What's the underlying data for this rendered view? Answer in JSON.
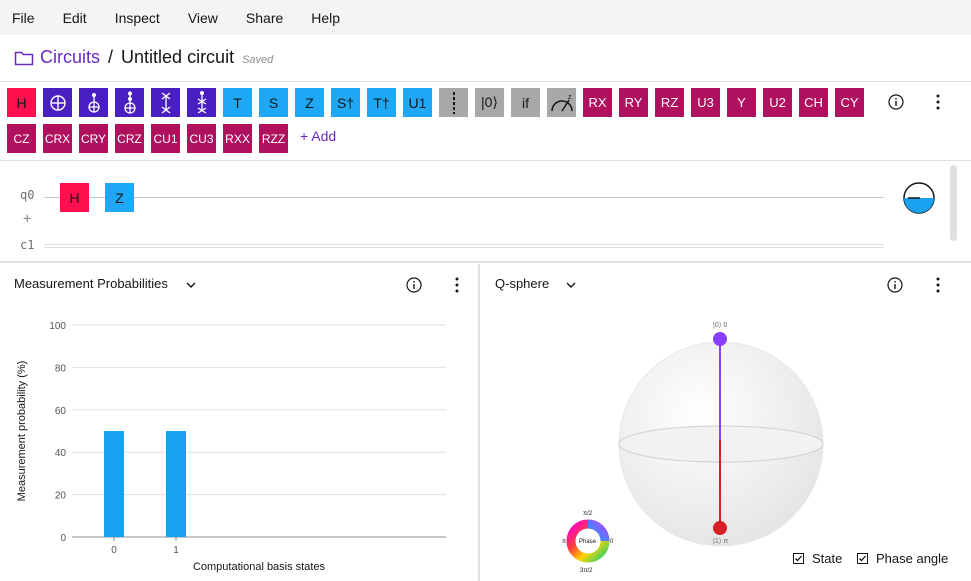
{
  "menu": [
    "File",
    "Edit",
    "Inspect",
    "View",
    "Share",
    "Help"
  ],
  "breadcrumb": {
    "root": "Circuits",
    "separator": "/",
    "title": "Untitled circuit",
    "status": "Saved"
  },
  "gates_row1": [
    {
      "label": "H",
      "kind": "red"
    },
    {
      "label": "",
      "kind": "purple",
      "icon": "cnot-icon"
    },
    {
      "label": "",
      "kind": "purple",
      "icon": "toffoli-icon"
    },
    {
      "label": "",
      "kind": "purple",
      "icon": "ccx-icon"
    },
    {
      "label": "",
      "kind": "purple",
      "icon": "swap-icon"
    },
    {
      "label": "",
      "kind": "purple",
      "icon": "cswap-icon"
    },
    {
      "label": "T",
      "kind": "blue"
    },
    {
      "label": "S",
      "kind": "blue"
    },
    {
      "label": "Z",
      "kind": "blue"
    },
    {
      "label": "S†",
      "kind": "blue"
    },
    {
      "label": "T†",
      "kind": "blue"
    },
    {
      "label": "U1",
      "kind": "blue"
    },
    {
      "label": "",
      "kind": "gray",
      "icon": "barrier-icon"
    },
    {
      "label": "|0⟩",
      "kind": "gray"
    },
    {
      "label": "if",
      "kind": "gray"
    },
    {
      "label": "",
      "kind": "gray",
      "icon": "measure-icon"
    },
    {
      "label": "RX",
      "kind": "magenta"
    },
    {
      "label": "RY",
      "kind": "magenta"
    },
    {
      "label": "RZ",
      "kind": "magenta"
    },
    {
      "label": "U3",
      "kind": "magenta"
    },
    {
      "label": "Y",
      "kind": "magenta"
    },
    {
      "label": "U2",
      "kind": "magenta"
    },
    {
      "label": "CH",
      "kind": "magenta"
    },
    {
      "label": "CY",
      "kind": "magenta"
    }
  ],
  "gates_row2": [
    {
      "label": "CZ",
      "kind": "magenta"
    },
    {
      "label": "CRX",
      "kind": "magenta"
    },
    {
      "label": "CRY",
      "kind": "magenta"
    },
    {
      "label": "CRZ",
      "kind": "magenta"
    },
    {
      "label": "CU1",
      "kind": "magenta"
    },
    {
      "label": "CU3",
      "kind": "magenta"
    },
    {
      "label": "RXX",
      "kind": "magenta"
    },
    {
      "label": "RZZ",
      "kind": "magenta"
    }
  ],
  "add_label": "+ Add",
  "circuit": {
    "qubit_label": "q0",
    "add_wire": "+",
    "classical_label": "c1",
    "placed_gates": [
      "H",
      "Z"
    ]
  },
  "measurement_panel": {
    "title": "Measurement Probabilities",
    "chart_data": {
      "type": "bar",
      "categories": [
        "0",
        "1"
      ],
      "values": [
        50,
        50
      ],
      "xlabel": "Computational basis states",
      "ylabel": "Measurement probability (%)",
      "ylim": [
        0,
        100
      ],
      "yticks": [
        "100",
        "80",
        "60",
        "40",
        "20",
        "0"
      ],
      "color": "#1ba1f2"
    }
  },
  "qsphere_panel": {
    "title": "Q-sphere",
    "top_label": "|0⟩ 0",
    "bottom_label": "|1⟩ π",
    "phase_wheel": {
      "center": "Phase",
      "top": "π/2",
      "left": "π",
      "right": "0",
      "bottom": "3π/2"
    },
    "options": [
      {
        "label": "State",
        "checked": true
      },
      {
        "label": "Phase angle",
        "checked": true
      }
    ]
  }
}
